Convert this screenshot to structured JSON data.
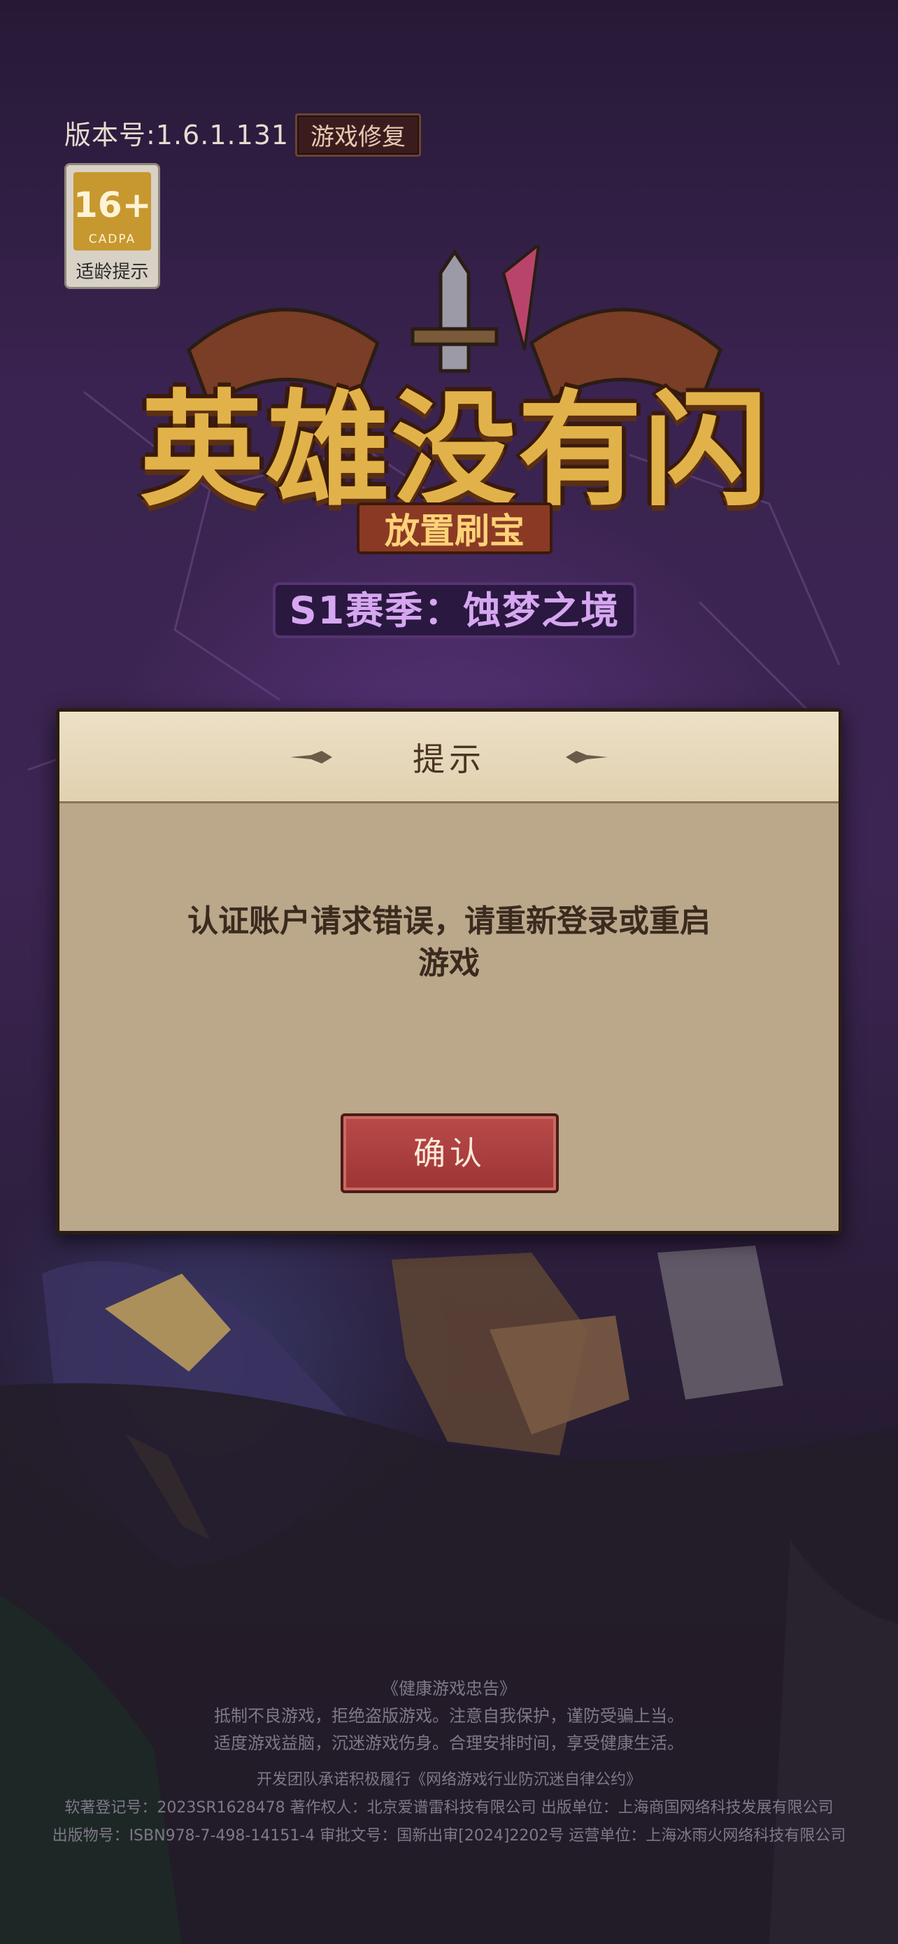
{
  "version": "版本号:1.6.1.131",
  "repair_button": "游戏修复",
  "age_rating": {
    "number": "16+",
    "org": "CADPA",
    "tip": "适龄提示"
  },
  "logo": {
    "title": "英雄没有闪",
    "subtitle": "放置刷宝",
    "season": "S1赛季：蚀梦之境"
  },
  "dialog": {
    "title": "提示",
    "message_line1": "认证账户请求错误，请重新登录或重启",
    "message_line2": "游戏",
    "confirm": "确认"
  },
  "footer": {
    "advice_title": "《健康游戏忠告》",
    "advice_line1": "抵制不良游戏，拒绝盗版游戏。注意自我保护，谨防受骗上当。",
    "advice_line2": "适度游戏益脑，沉迷游戏伤身。合理安排时间，享受健康生活。",
    "pledge": "开发团队承诺积极履行《网络游戏行业防沉迷自律公约》",
    "copyright": "软著登记号：2023SR1628478 著作权人：北京爱谱雷科技有限公司 出版单位：上海商国网络科技发展有限公司",
    "publication": "出版物号：ISBN978-7-498-14151-4 审批文号：国新出审[2024]2202号 运营单位：上海冰雨火网络科技有限公司"
  }
}
